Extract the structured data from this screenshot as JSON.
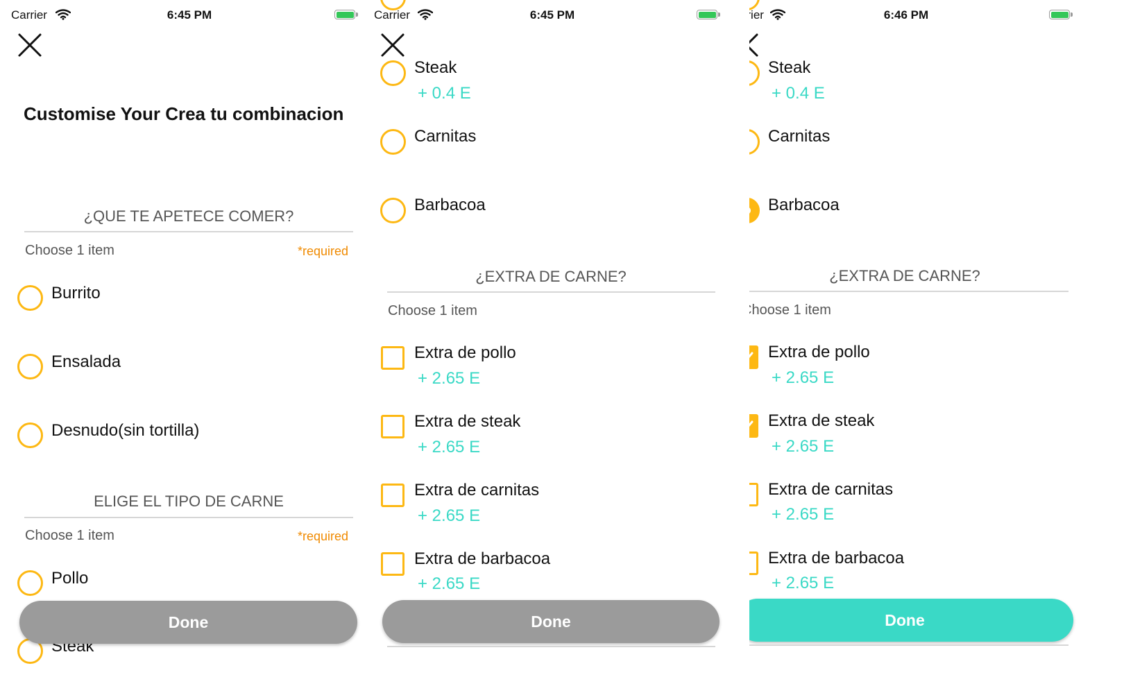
{
  "colors": {
    "accent": "#fdb813",
    "price": "#3ad9c6",
    "required": "#f08a00",
    "done_disabled": "#9b9b9b",
    "done_enabled": "#3ad9c6",
    "battery": "#34c759"
  },
  "panels": [
    {
      "status": {
        "carrier": "Carrier",
        "time": "6:45 PM",
        "wifi_icon": "wifi-icon",
        "battery_icon": "battery-icon"
      },
      "close_icon": "close-icon",
      "title": "Customise Your Crea tu combinacion",
      "sections": [
        {
          "title": "¿QUE TE APETECE COMER?",
          "choose": "Choose 1 item",
          "required": "*required",
          "options": [
            {
              "label": "Burrito",
              "selected": false
            },
            {
              "label": "Ensalada",
              "selected": false
            },
            {
              "label": "Desnudo(sin tortilla)",
              "selected": false
            }
          ]
        },
        {
          "title": "ELIGE EL TIPO DE CARNE",
          "choose": "Choose 1 item",
          "required": "*required",
          "options": [
            {
              "label": "Pollo",
              "selected": false
            },
            {
              "label": "Steak",
              "selected": false
            }
          ]
        }
      ],
      "done": {
        "label": "Done",
        "enabled": false
      }
    },
    {
      "status": {
        "carrier": "Carrier",
        "time": "6:45 PM",
        "charging": "⚡",
        "wifi_icon": "wifi-icon",
        "battery_icon": "battery-icon"
      },
      "close_icon": "close-icon",
      "meat_options": [
        {
          "label": "Steak",
          "price": "+ 0.4 E",
          "selected": false
        },
        {
          "label": "Carnitas",
          "selected": false
        },
        {
          "label": "Barbacoa",
          "selected": false
        }
      ],
      "extra_section": {
        "title": "¿EXTRA DE CARNE?",
        "choose": "Choose 1 item",
        "options": [
          {
            "label": "Extra de pollo",
            "price": "+ 2.65 E",
            "checked": false
          },
          {
            "label": "Extra de steak",
            "price": "+ 2.65 E",
            "checked": false
          },
          {
            "label": "Extra de carnitas",
            "price": "+ 2.65 E",
            "checked": false
          },
          {
            "label": "Extra de barbacoa",
            "price": "+ 2.65 E",
            "checked": false
          }
        ]
      },
      "done": {
        "label": "Done",
        "enabled": false
      }
    },
    {
      "status": {
        "carrier": "Carrier",
        "time": "6:46 PM",
        "wifi_icon": "wifi-icon",
        "battery_icon": "battery-icon"
      },
      "close_icon": "close-icon",
      "meat_options": [
        {
          "label": "Steak",
          "price": "+ 0.4 E",
          "selected": false
        },
        {
          "label": "Carnitas",
          "selected": false
        },
        {
          "label": "Barbacoa",
          "selected": true
        }
      ],
      "extra_section": {
        "title": "¿EXTRA DE CARNE?",
        "choose": "Choose 1 item",
        "options": [
          {
            "label": "Extra de pollo",
            "price": "+ 2.65 E",
            "checked": true
          },
          {
            "label": "Extra de steak",
            "price": "+ 2.65 E",
            "checked": true
          },
          {
            "label": "Extra de carnitas",
            "price": "+ 2.65 E",
            "checked": false
          },
          {
            "label": "Extra de barbacoa",
            "price": "+ 2.65 E",
            "checked": false
          }
        ]
      },
      "done": {
        "label": "Done",
        "enabled": true
      }
    }
  ]
}
